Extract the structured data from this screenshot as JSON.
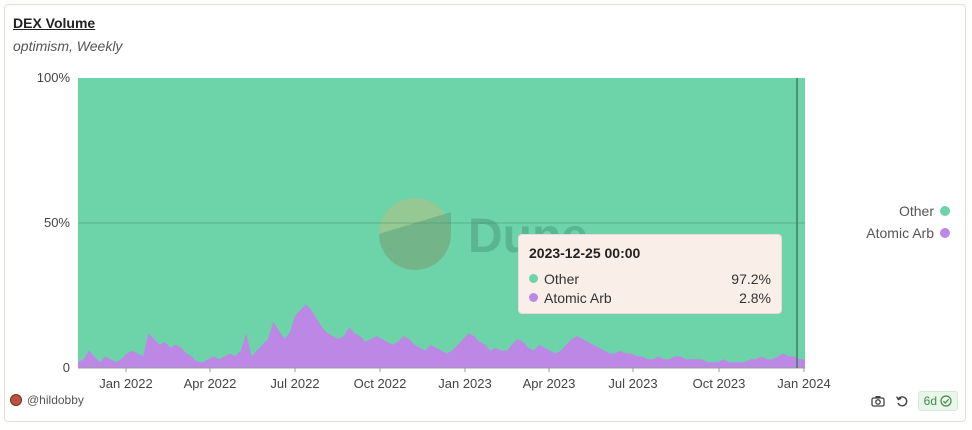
{
  "header": {
    "title": "DEX Volume",
    "subtitle": "optimism, Weekly"
  },
  "watermark": "Dune",
  "colors": {
    "other": "#6dd3a8",
    "atomic_arb": "#bd87e6"
  },
  "legend": [
    {
      "label": "Other",
      "color": "#6dd3a8"
    },
    {
      "label": "Atomic Arb",
      "color": "#bd87e6"
    }
  ],
  "tooltip": {
    "date": "2023-12-25 00:00",
    "rows": [
      {
        "name": "Other",
        "value": "97.2%",
        "color": "#6dd3a8"
      },
      {
        "name": "Atomic Arb",
        "value": "2.8%",
        "color": "#bd87e6"
      }
    ]
  },
  "footer": {
    "author": "@hildobby",
    "refresh_badge": "6d",
    "icons": [
      "camera-icon",
      "refresh-icon",
      "check-circle-icon"
    ]
  },
  "chart_data": {
    "type": "area",
    "stacked": true,
    "normalized": true,
    "series": [
      {
        "name": "Atomic Arb",
        "values": [
          2,
          3,
          6,
          4,
          2,
          4,
          3,
          2,
          3,
          5,
          6,
          5,
          4,
          12,
          10,
          8,
          9,
          7,
          8,
          7,
          5,
          4,
          2,
          2,
          3,
          4,
          3,
          4,
          5,
          4,
          6,
          12,
          4,
          6,
          8,
          10,
          16,
          13,
          10,
          12,
          18,
          20,
          22,
          20,
          17,
          14,
          12,
          11,
          10,
          11,
          14,
          12,
          11,
          9,
          10,
          11,
          10,
          9,
          8,
          9,
          11,
          10,
          8,
          7,
          6,
          8,
          7,
          6,
          5,
          6,
          8,
          10,
          12,
          11,
          9,
          8,
          6,
          7,
          6,
          6,
          8,
          10,
          9,
          7,
          6,
          8,
          7,
          6,
          5,
          6,
          8,
          10,
          11,
          10,
          9,
          8,
          7,
          6,
          5,
          5,
          6,
          5,
          5,
          4,
          4,
          3,
          3,
          4,
          3,
          3,
          4,
          4,
          3,
          3,
          3,
          3,
          2,
          2,
          2,
          3,
          2,
          2,
          2,
          2,
          3,
          3,
          4,
          3,
          3,
          4,
          5,
          4,
          4,
          3,
          3
        ]
      },
      {
        "name": "Other"
      }
    ],
    "x_ticks": [
      "Jan 2022",
      "Apr 2022",
      "Jul 2022",
      "Oct 2022",
      "Jan 2023",
      "Apr 2023",
      "Jul 2023",
      "Oct 2023",
      "Jan 2024"
    ],
    "y_ticks": [
      "0",
      "50%",
      "100%"
    ],
    "ylim": [
      0,
      100
    ],
    "grid": true,
    "legend_position": "right",
    "highlighted_point": {
      "date": "2023-12-25 00:00",
      "Other": 97.2,
      "Atomic Arb": 2.8
    }
  }
}
